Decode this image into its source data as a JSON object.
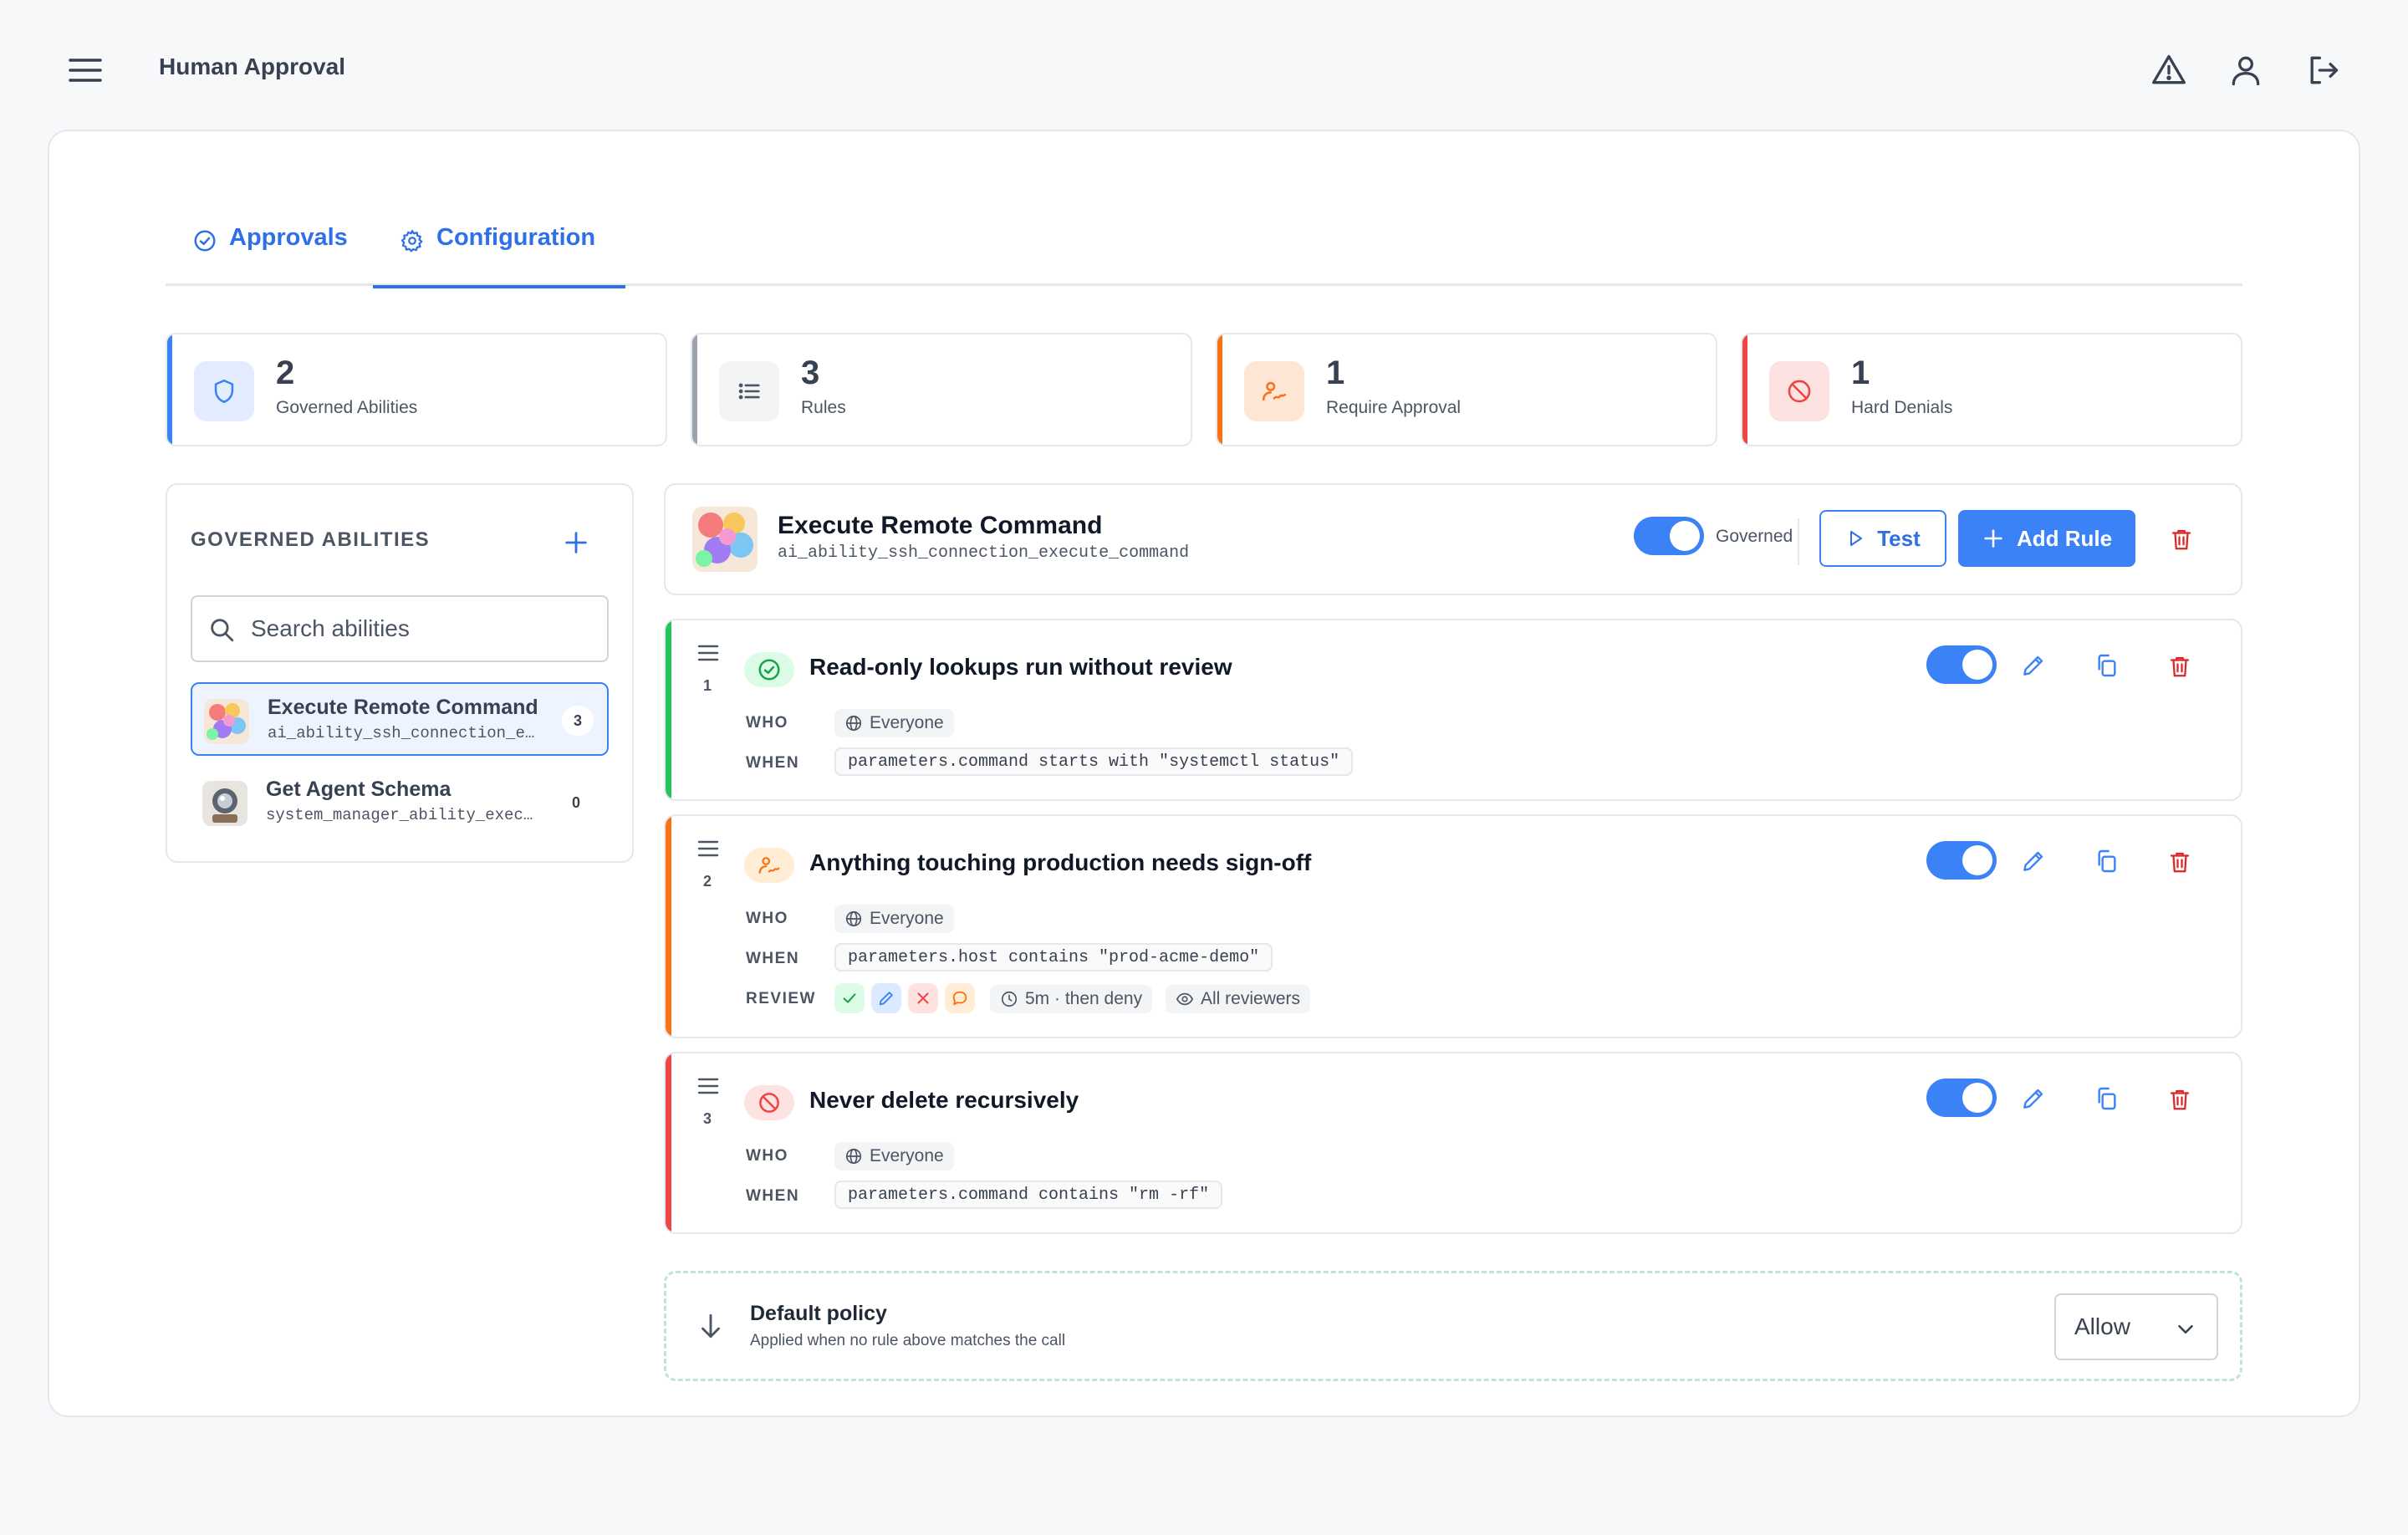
{
  "app": {
    "title": "Human Approval"
  },
  "header_icons": [
    "menu-icon",
    "alert-triangle-icon",
    "user-icon",
    "logout-icon"
  ],
  "tabs": [
    {
      "label": "Approvals",
      "icon": "check-circle-icon",
      "active": false
    },
    {
      "label": "Configuration",
      "icon": "gear-icon",
      "active": true
    }
  ],
  "stats": [
    {
      "value": "2",
      "label": "Governed Abilities",
      "icon": "shield-icon",
      "color": "#3b82f6"
    },
    {
      "value": "3",
      "label": "Rules",
      "icon": "list-icon",
      "color": "#9ca3af"
    },
    {
      "value": "1",
      "label": "Require Approval",
      "icon": "signature-icon",
      "color": "#f97316"
    },
    {
      "value": "1",
      "label": "Hard Denials",
      "icon": "ban-icon",
      "color": "#ef4444"
    }
  ],
  "sidebar": {
    "title": "GOVERNED ABILITIES",
    "search_placeholder": "Search abilities",
    "items": [
      {
        "name": "Execute Remote Command",
        "id": "ai_ability_ssh_connection_e…",
        "count": "3",
        "selected": true
      },
      {
        "name": "Get Agent Schema",
        "id": "system_manager_ability_exec…",
        "count": "0",
        "selected": false
      }
    ]
  },
  "ability": {
    "name": "Execute Remote Command",
    "id": "ai_ability_ssh_connection_execute_command",
    "governed_label": "Governed",
    "governed": true,
    "test_label": "Test",
    "add_rule_label": "Add Rule"
  },
  "labels": {
    "who": "WHO",
    "when": "WHEN",
    "review": "REVIEW"
  },
  "rules": [
    {
      "number": "1",
      "title": "Read-only lookups run without review",
      "kind": "allow",
      "color": "#22c55e",
      "who": "Everyone",
      "when": "parameters.command starts with \"systemctl status\"",
      "enabled": true
    },
    {
      "number": "2",
      "title": "Anything touching production needs sign-off",
      "kind": "approval",
      "color": "#f97316",
      "who": "Everyone",
      "when": "parameters.host contains \"prod-acme-demo\"",
      "review": {
        "actions": [
          "approve-icon",
          "edit-icon",
          "deny-icon",
          "comment-icon"
        ],
        "timeout": "5m · then deny",
        "reviewers": "All reviewers"
      },
      "enabled": true
    },
    {
      "number": "3",
      "title": "Never delete recursively",
      "kind": "deny",
      "color": "#ef4444",
      "who": "Everyone",
      "when": "parameters.command contains \"rm -rf\"",
      "enabled": true
    }
  ],
  "default_policy": {
    "title": "Default policy",
    "subtitle": "Applied when no rule above matches the call",
    "value": "Allow"
  },
  "colors": {
    "accent": "#3b82f6",
    "allow": "#22c55e",
    "approval": "#f97316",
    "deny": "#ef4444"
  }
}
